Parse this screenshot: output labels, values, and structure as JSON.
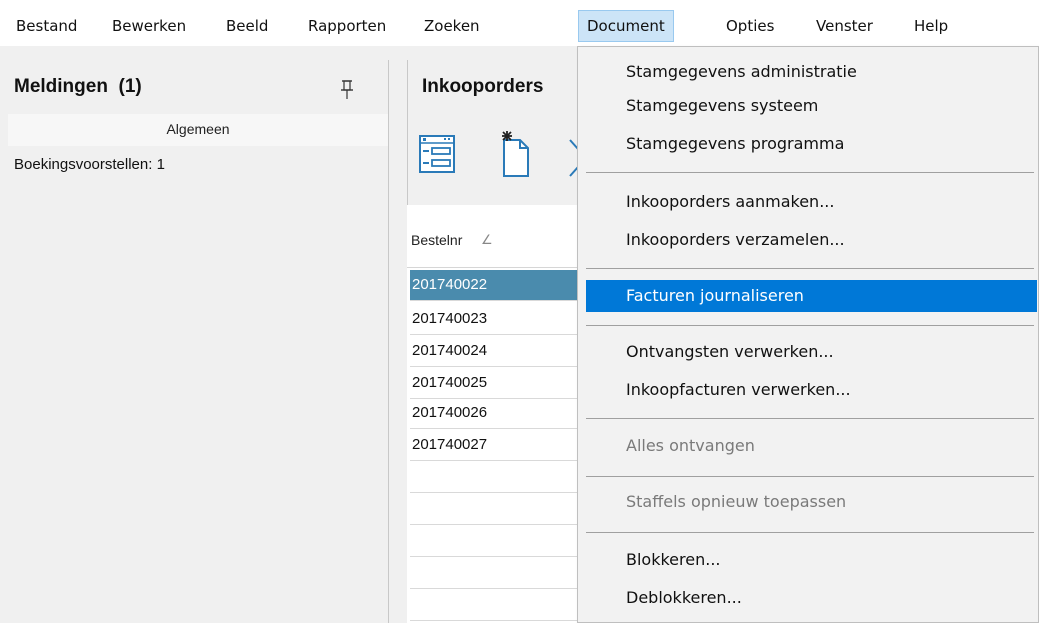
{
  "menubar": {
    "items": [
      "Bestand",
      "Bewerken",
      "Beeld",
      "Rapporten",
      "Zoeken",
      "Document",
      "Opties",
      "Venster",
      "Help"
    ],
    "open_index": 5
  },
  "notifications": {
    "title": "Meldingen  (1)",
    "group": "Algemeen",
    "items": [
      "Boekingsvoorstellen: 1"
    ],
    "pin_icon": "pin-icon"
  },
  "document_panel": {
    "title": "Inkooporders",
    "toolbar_icons": [
      "list-icon",
      "new-document-icon",
      "close-icon"
    ],
    "column_header": "Bestelnr",
    "sort_glyph": "∠",
    "rows": [
      "201740022",
      "201740023",
      "201740024",
      "201740025",
      "201740026",
      "201740027"
    ],
    "selected_row": 0
  },
  "dropdown": {
    "items": [
      {
        "label": "Stamgegevens administratie",
        "enabled": true
      },
      {
        "label": "Stamgegevens systeem",
        "enabled": true
      },
      {
        "label": "Stamgegevens programma",
        "enabled": true
      },
      {
        "label": "Inkooporders aanmaken...",
        "enabled": true
      },
      {
        "label": "Inkooporders verzamelen...",
        "enabled": true
      },
      {
        "label": "Facturen journaliseren",
        "enabled": true,
        "highlighted": true
      },
      {
        "label": "Ontvangsten verwerken...",
        "enabled": true
      },
      {
        "label": "Inkoopfacturen verwerken...",
        "enabled": true
      },
      {
        "label": "Alles ontvangen",
        "enabled": false
      },
      {
        "label": "Staffels opnieuw toepassen",
        "enabled": false
      },
      {
        "label": "Blokkeren...",
        "enabled": true
      },
      {
        "label": "Deblokkeren...",
        "enabled": true
      }
    ]
  },
  "colors": {
    "menu_highlight": "#0078d7",
    "row_selected": "#4a8bad",
    "open_menu_bg": "#cce4f7"
  }
}
